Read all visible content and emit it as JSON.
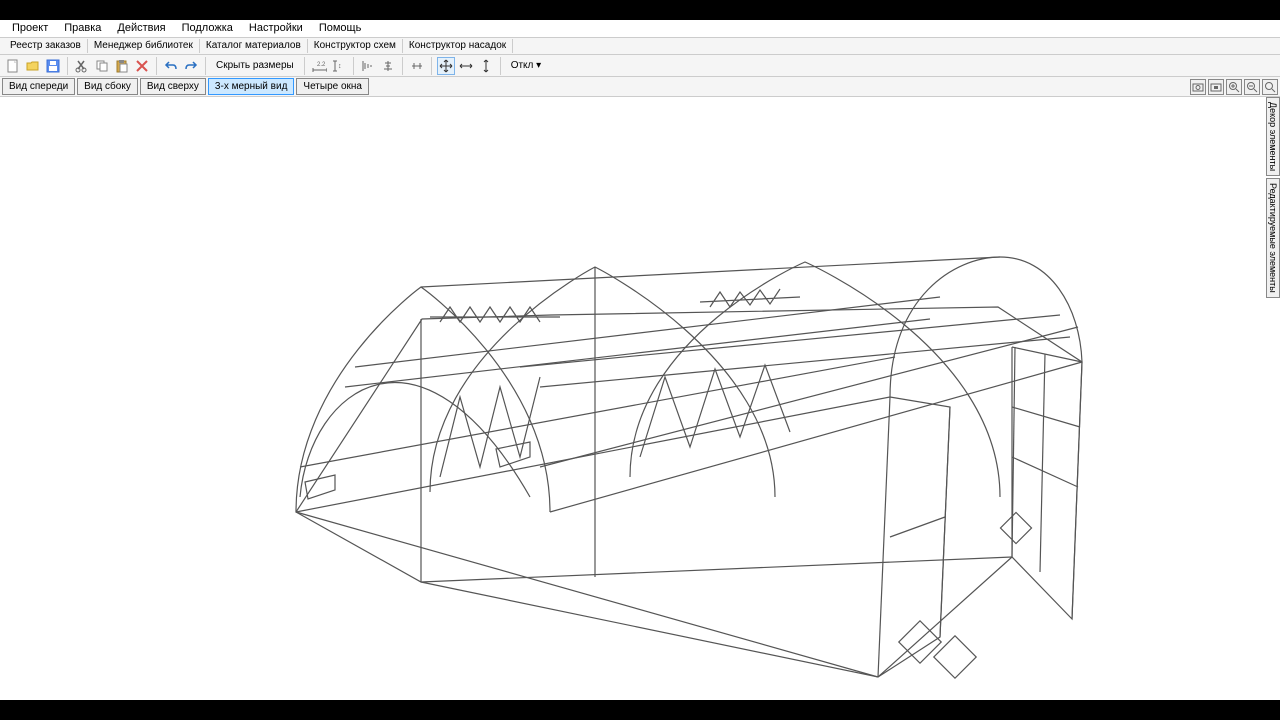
{
  "menubar": {
    "items": [
      "Проект",
      "Правка",
      "Действия",
      "Подложка",
      "Настройки",
      "Помощь"
    ]
  },
  "secondbar": {
    "items": [
      "Реестр заказов",
      "Менеджер библиотек",
      "Каталог материалов",
      "Конструктор схем",
      "Конструктор насадок"
    ]
  },
  "toolbar": {
    "hide_dimensions": "Скрыть размеры",
    "deviation_label": "Откл"
  },
  "viewbar": {
    "front": "Вид спереди",
    "side": "Вид сбоку",
    "top": "Вид сверху",
    "three_d": "3-х мерный вид",
    "four_windows": "Четыре окна"
  },
  "side_tabs": {
    "decor": "Декор элементы",
    "editable": "Редактируемые элементы"
  }
}
